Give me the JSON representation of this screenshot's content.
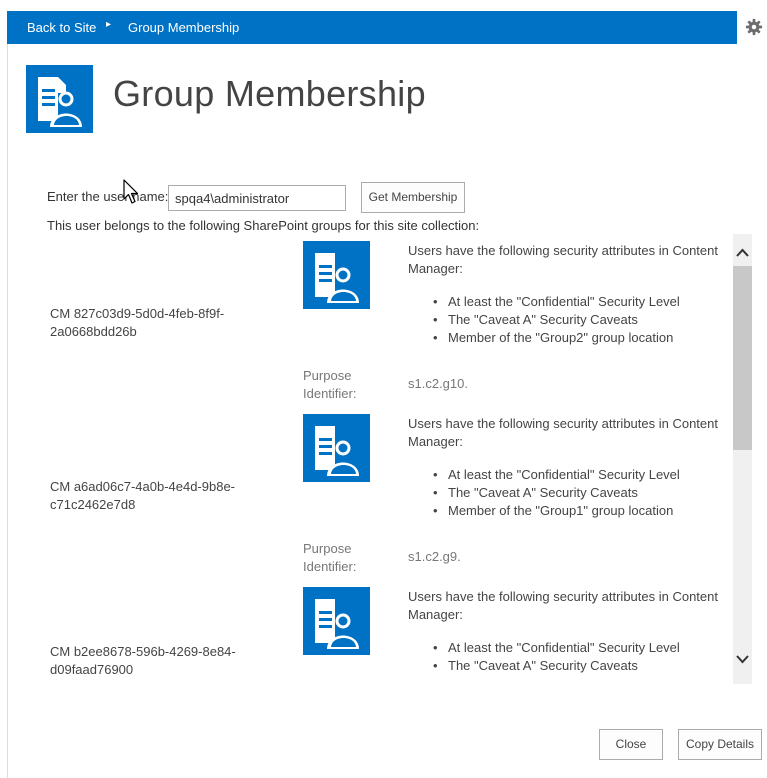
{
  "topbar": {
    "back_link": "Back to Site",
    "separator": "▸",
    "crumb": "Group Membership",
    "settings_icon": "gear-icon"
  },
  "page": {
    "title": "Group Membership",
    "icon": "group-membership-icon"
  },
  "form": {
    "label": "Enter the user name:",
    "input_value": "spqa4\\administrator",
    "button": "Get Membership"
  },
  "belongs_text": "This user belongs to the following SharePoint groups for this site collection:",
  "entries": [
    {
      "cm_line1": "CM 827c03d9-5d0d-4feb-8f9f-",
      "cm_line2": "2a0668bdd26b",
      "desc_line1": "Users have the following security attributes in Content",
      "desc_line2": "Manager:",
      "attrs": [
        "At least the \"Confidential\" Security Level",
        "The \"Caveat A\" Security Caveats",
        "Member of the \"Group2\" group location"
      ],
      "purpose_label1": "Purpose",
      "purpose_label2": "Identifier:",
      "purpose_value": "s1.c2.g10."
    },
    {
      "cm_line1": "CM a6ad06c7-4a0b-4e4d-9b8e-",
      "cm_line2": "c71c2462e7d8",
      "desc_line1": "Users have the following security attributes in Content",
      "desc_line2": "Manager:",
      "attrs": [
        "At least the \"Confidential\" Security Level",
        "The \"Caveat A\" Security Caveats",
        "Member of the \"Group1\" group location"
      ],
      "purpose_label1": "Purpose",
      "purpose_label2": "Identifier:",
      "purpose_value": "s1.c2.g9."
    },
    {
      "cm_line1": "CM b2ee8678-596b-4269-8e84-",
      "cm_line2": "d09faad76900",
      "desc_line1": "Users have the following security attributes in Content",
      "desc_line2": "Manager:",
      "attrs": [
        "At least the \"Confidential\" Security Level",
        "The \"Caveat A\" Security Caveats"
      ]
    }
  ],
  "footer": {
    "close": "Close",
    "copy": "Copy Details"
  },
  "colors": {
    "topbar": "#0072c6",
    "icon_bg": "#0072c6"
  }
}
